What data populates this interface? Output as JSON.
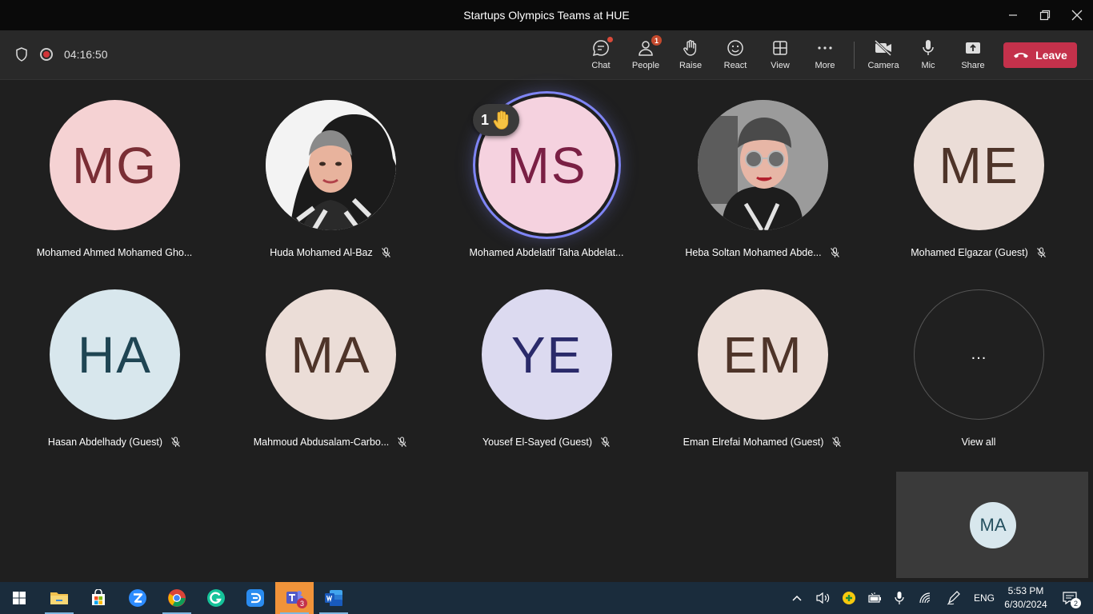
{
  "window": {
    "title": "Startups Olympics Teams at HUE"
  },
  "toolbar": {
    "timer": "04:16:50",
    "buttons": {
      "chat": "Chat",
      "people": "People",
      "people_badge": "1",
      "raise": "Raise",
      "react": "React",
      "view": "View",
      "more": "More",
      "camera": "Camera",
      "mic": "Mic",
      "share": "Share"
    },
    "leave_label": "Leave"
  },
  "participants": [
    {
      "initials": "MG",
      "name": "Mohamed Ahmed Mohamed Gho...",
      "muted": false,
      "bg": "#f5d2d3",
      "fg": "#7a2e35"
    },
    {
      "initials": "",
      "name": "Huda Mohamed Al-Baz",
      "muted": true,
      "photo": "huda"
    },
    {
      "initials": "MS",
      "name": "Mohamed Abdelatif Taha Abdelat...",
      "muted": false,
      "bg": "#f5d2df",
      "fg": "#7a1f44",
      "speaking": true
    },
    {
      "initials": "",
      "name": "Heba Soltan Mohamed Abde...",
      "muted": true,
      "photo": "heba"
    },
    {
      "initials": "ME",
      "name": "Mohamed Elgazar (Guest)",
      "muted": true,
      "bg": "#ebddd7",
      "fg": "#4e3429"
    },
    {
      "initials": "HA",
      "name": "Hasan Abdelhady (Guest)",
      "muted": true,
      "bg": "#d8e7ed",
      "fg": "#1f4553"
    },
    {
      "initials": "MA",
      "name": "Mahmoud Abdusalam-Carbo...",
      "muted": true,
      "bg": "#ebddd7",
      "fg": "#4e3429"
    },
    {
      "initials": "YE",
      "name": "Yousef El-Sayed (Guest)",
      "muted": true,
      "bg": "#dcdaf0",
      "fg": "#2a2a6a"
    },
    {
      "initials": "EM",
      "name": "Eman Elrefai Mohamed (Guest)",
      "muted": true,
      "bg": "#ebddd7",
      "fg": "#4e3429"
    }
  ],
  "view_all": {
    "label": "View all",
    "icon": "..."
  },
  "raise_hand": {
    "count": "1"
  },
  "self_view": {
    "initials": "MA"
  },
  "taskbar": {
    "teams_badge": "3",
    "language": "ENG",
    "time": "5:53 PM",
    "date": "6/30/2024",
    "notifications": "2"
  }
}
